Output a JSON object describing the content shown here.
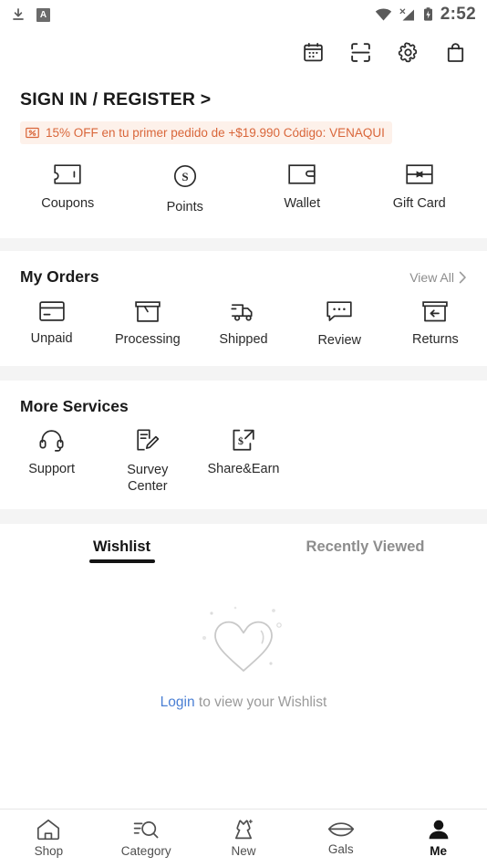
{
  "status_bar": {
    "time": "2:52",
    "left_icons": [
      "download-icon",
      "a-badge-icon"
    ],
    "right_icons": [
      "wifi-icon",
      "cell-signal-off-icon",
      "battery-charging-icon"
    ]
  },
  "top_actions": [
    {
      "name": "check-in-calendar-icon",
      "label": "Check In"
    },
    {
      "name": "scan-icon",
      "label": "Scan"
    },
    {
      "name": "settings-gear-icon",
      "label": "Settings"
    },
    {
      "name": "shopping-bag-icon",
      "label": "Cart"
    }
  ],
  "account": {
    "signin_label": "SIGN IN / REGISTER >",
    "promo": {
      "icon": "coupon-percent-icon",
      "text": "15% OFF en tu primer pedido de +$19.990 Código: VENAQUI",
      "text_color": "#d9663a",
      "background_color": "#fdf1ea"
    }
  },
  "quick_actions": [
    {
      "icon": "ticket-icon",
      "label": "Coupons"
    },
    {
      "icon": "points-coin-icon",
      "label": "Points"
    },
    {
      "icon": "wallet-icon",
      "label": "Wallet"
    },
    {
      "icon": "gift-card-icon",
      "label": "Gift Card"
    }
  ],
  "my_orders": {
    "title": "My Orders",
    "view_all_label": "View All",
    "view_all_chevron": "chevron-right-icon",
    "items": [
      {
        "icon": "unpaid-card-icon",
        "label": "Unpaid"
      },
      {
        "icon": "package-box-icon",
        "label": "Processing"
      },
      {
        "icon": "delivery-truck-icon",
        "label": "Shipped"
      },
      {
        "icon": "review-bubble-icon",
        "label": "Review"
      },
      {
        "icon": "returns-icon",
        "label": "Returns"
      }
    ]
  },
  "more_services": {
    "title": "More Services",
    "items": [
      {
        "icon": "headset-icon",
        "label": "Support"
      },
      {
        "icon": "survey-edit-icon",
        "label": "Survey Center"
      },
      {
        "icon": "share-earn-icon",
        "label": "Share&Earn"
      }
    ]
  },
  "wishlist_section": {
    "tabs": [
      {
        "label": "Wishlist",
        "active": true
      },
      {
        "label": "Recently Viewed",
        "active": false
      }
    ],
    "empty_state": {
      "illustration": "heart-outline-icon",
      "login_link": "Login",
      "message": " to view your Wishlist",
      "link_color": "#4a7fd4"
    }
  },
  "bottom_nav": [
    {
      "icon": "home-icon",
      "label": "Shop",
      "active": false
    },
    {
      "icon": "category-search-icon",
      "label": "Category",
      "active": false
    },
    {
      "icon": "dress-new-icon",
      "label": "New",
      "active": false
    },
    {
      "icon": "lips-gals-icon",
      "label": "Gals",
      "active": false
    },
    {
      "icon": "person-icon",
      "label": "Me",
      "active": true
    }
  ]
}
